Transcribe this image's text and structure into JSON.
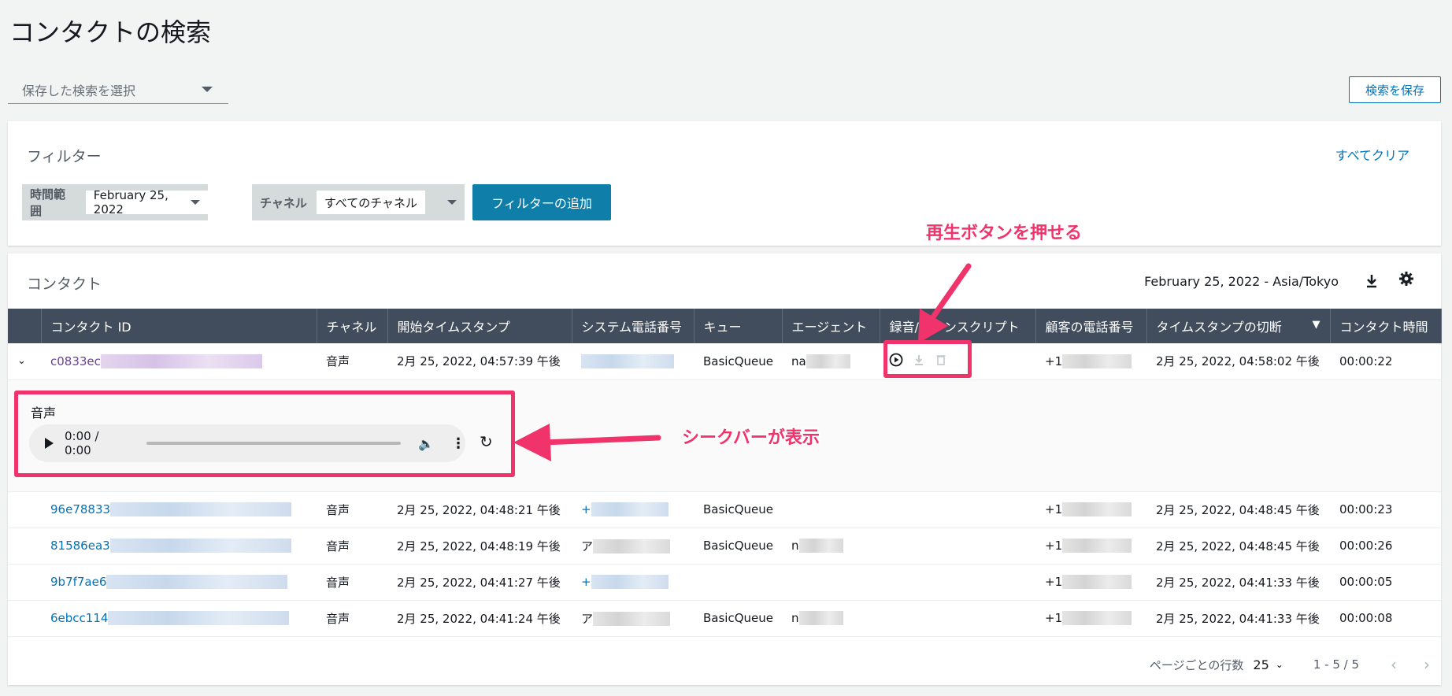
{
  "page": {
    "title": "コンタクトの検索",
    "saved_search_placeholder": "保存した検索を選択",
    "save_search_label": "検索を保存"
  },
  "filters": {
    "title": "フィルター",
    "clear_all": "すべてクリア",
    "time_range_label": "時間範囲",
    "time_range_value": "February 25, 2022",
    "channel_label": "チャネル",
    "channel_value": "すべてのチャネル",
    "add_filter": "フィルターの追加"
  },
  "contacts": {
    "title": "コンタクト",
    "timezone": "February 25, 2022 - Asia/Tokyo",
    "columns": [
      "コンタクト ID",
      "チャネル",
      "開始タイムスタンプ",
      "システム電話番号",
      "キュー",
      "エージェント",
      "録音/トランスクリプト",
      "顧客の電話番号",
      "タイムスタンプの切断",
      "コンタクト時間"
    ],
    "rows": [
      {
        "id": "c0833ec",
        "channel": "音声",
        "start": "2月 25, 2022, 04:57:39 午後",
        "system_phone": "",
        "queue": "BasicQueue",
        "agent": "na",
        "customer_phone": "+1",
        "disconnect": "2月 25, 2022, 04:58:02 午後",
        "duration": "00:00:22"
      },
      {
        "id": "96e78833",
        "channel": "音声",
        "start": "2月 25, 2022, 04:48:21 午後",
        "system_phone": "+",
        "queue": "BasicQueue",
        "agent": "",
        "customer_phone": "+1",
        "disconnect": "2月 25, 2022, 04:48:45 午後",
        "duration": "00:00:23"
      },
      {
        "id": "81586ea3",
        "channel": "音声",
        "start": "2月 25, 2022, 04:48:19 午後",
        "system_phone": "ア",
        "queue": "BasicQueue",
        "agent": "n",
        "customer_phone": "+1",
        "disconnect": "2月 25, 2022, 04:48:45 午後",
        "duration": "00:00:26"
      },
      {
        "id": "9b7f7ae6",
        "channel": "音声",
        "start": "2月 25, 2022, 04:41:27 午後",
        "system_phone": "+",
        "queue": "",
        "agent": "",
        "customer_phone": "+1",
        "disconnect": "2月 25, 2022, 04:41:33 午後",
        "duration": "00:00:05"
      },
      {
        "id": "6ebcc114",
        "channel": "音声",
        "start": "2月 25, 2022, 04:41:24 午後",
        "system_phone": "ア",
        "queue": "BasicQueue",
        "agent": "n",
        "customer_phone": "+1",
        "disconnect": "2月 25, 2022, 04:41:33 午後",
        "duration": "00:00:08"
      }
    ],
    "sort_indicator": "▼"
  },
  "audio": {
    "label": "音声",
    "time": "0:00 / 0:00"
  },
  "annotations": {
    "play_button": "再生ボタンを押せる",
    "seek_bar": "シークバーが表示",
    "color": "#f0336b"
  },
  "pagination": {
    "rows_per_page_label": "ページごとの行数",
    "rows_per_page": "25",
    "range": "1 - 5 / 5"
  }
}
